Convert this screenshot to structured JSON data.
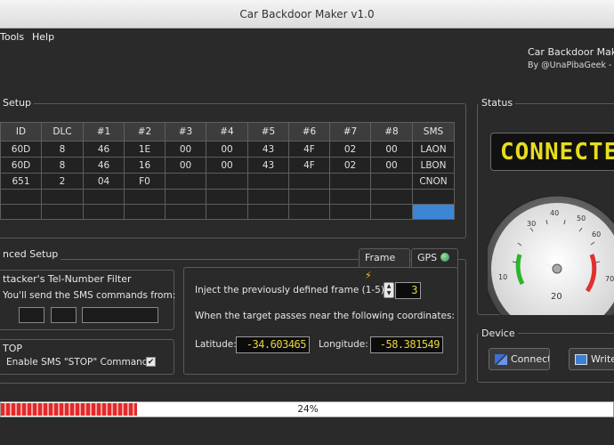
{
  "window": {
    "title": "Car Backdoor Maker v1.0"
  },
  "menu": {
    "tools": "Tools",
    "help": "Help"
  },
  "header": {
    "app_title": "Car Backdoor Maker",
    "author": "By @UnaPibaGeek - @"
  },
  "setup": {
    "title": "Setup",
    "columns": [
      "ID",
      "DLC",
      "#1",
      "#2",
      "#3",
      "#4",
      "#5",
      "#6",
      "#7",
      "#8",
      "SMS"
    ],
    "rows": [
      [
        "60D",
        "8",
        "46",
        "1E",
        "00",
        "00",
        "43",
        "4F",
        "02",
        "00",
        "LAON"
      ],
      [
        "60D",
        "8",
        "46",
        "16",
        "00",
        "00",
        "43",
        "4F",
        "02",
        "00",
        "LBON"
      ],
      [
        "651",
        "2",
        "04",
        "F0",
        "",
        "",
        "",
        "",
        "",
        "",
        "CNON"
      ]
    ]
  },
  "status": {
    "title": "Status",
    "lcd_text": "CONNECTED",
    "gauge_labels": [
      "30",
      "40",
      "50",
      "60",
      "10",
      "20",
      "70"
    ]
  },
  "advanced": {
    "title": "nced Setup",
    "tel_filter": {
      "title": "ttacker's Tel-Number Filter",
      "text": "You'll send the SMS commands from:"
    },
    "stop": {
      "title": "TOP",
      "label": "Enable SMS \"STOP\" Command?"
    },
    "tabs": {
      "frame": "Frame",
      "gps": "GPS"
    },
    "inject_label": "Inject the previously defined frame (1-5):",
    "inject_value": "3",
    "coords_label": "When the target passes near the following coordinates:",
    "latitude_label": "Latitude:",
    "latitude_value": "-34.603465",
    "longitude_label": "Longitude:",
    "longitude_value": "-58.381549"
  },
  "device": {
    "title": "Device",
    "connect": "Connect",
    "write": "Write"
  },
  "progress": {
    "value": 0.24,
    "text": "24%"
  },
  "colors": {
    "accent": "#e8dd1c",
    "selection": "#3d86d6",
    "progress": "#e02a2a"
  }
}
